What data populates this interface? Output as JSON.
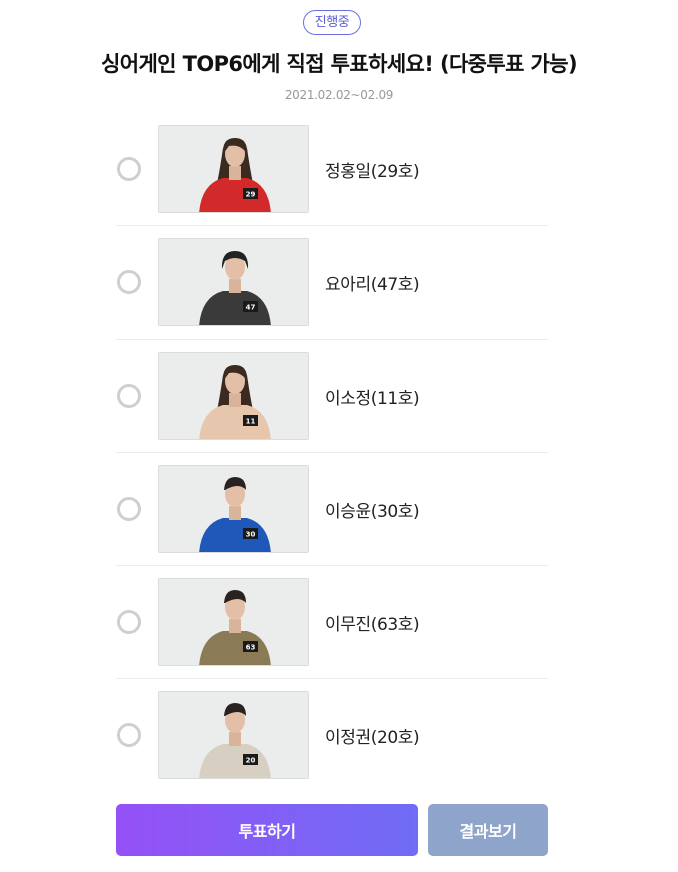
{
  "poll": {
    "status_badge": "진행중",
    "title": "싱어게인 TOP6에게 직접 투표하세요! (다중투표 가능)",
    "period": "2021.02.02~02.09"
  },
  "candidates": [
    {
      "name": "정홍일(29호)",
      "tag": "29",
      "outfit": "#d2292b",
      "hair": "long"
    },
    {
      "name": "요아리(47호)",
      "tag": "47",
      "outfit": "#3a3a3a",
      "hair": "bob"
    },
    {
      "name": "이소정(11호)",
      "tag": "11",
      "outfit": "#e6c7ad",
      "hair": "longwave"
    },
    {
      "name": "이승윤(30호)",
      "tag": "30",
      "outfit": "#1f58b8",
      "hair": "short"
    },
    {
      "name": "이무진(63호)",
      "tag": "63",
      "outfit": "#8a7a56",
      "hair": "short"
    },
    {
      "name": "이정권(20호)",
      "tag": "20",
      "outfit": "#d8cfc3",
      "hair": "short"
    }
  ],
  "buttons": {
    "vote_label": "투표하기",
    "result_label": "결과보기"
  },
  "colors": {
    "accent": "#6c6ee0",
    "vote_gradient_start": "#9551f6",
    "vote_gradient_end": "#6f6cf5",
    "result_button": "#8fa4ca",
    "radio_border": "#cfcfcf"
  }
}
